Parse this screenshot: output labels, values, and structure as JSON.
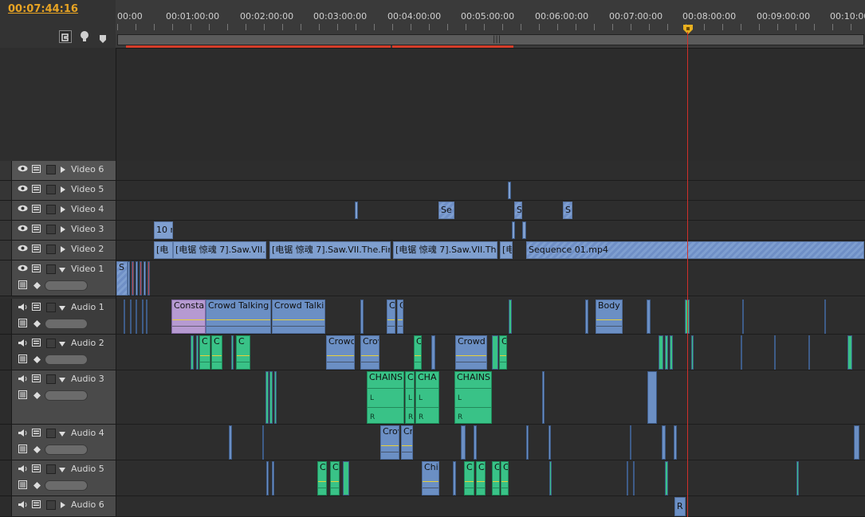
{
  "timecode": "00:07:44:16",
  "ruler": {
    "labels": [
      "00:00",
      "00:01:00:00",
      "00:02:00:00",
      "00:03:00:00",
      "00:04:00:00",
      "00:05:00:00",
      "00:06:00:00",
      "00:07:00:00",
      "00:08:00:00",
      "00:09:00:00",
      "00:10:00"
    ]
  },
  "header_icons": [
    "snap-icon",
    "marker-icon",
    "set-marker-icon"
  ],
  "tracks": {
    "video6": "Video 6",
    "video5": "Video 5",
    "video4": "Video 4",
    "video3": "Video 3",
    "video2": "Video 2",
    "video1": "Video 1",
    "audio1": "Audio 1",
    "audio2": "Audio 2",
    "audio3": "Audio 3",
    "audio4": "Audio 4",
    "audio5": "Audio 5",
    "audio6": "Audio 6"
  },
  "clips": {
    "v4_se": "Se",
    "v4_s1": "S",
    "v4_s2": "S",
    "v3_10": "10 r",
    "v2_c1": "[电",
    "v2_c2": "[电锯 惊魂 7].Saw.VII.",
    "v2_c3": "[电锯 惊魂 7].Saw.VII.The.Fin",
    "v2_c4": "[电锯 惊魂 7].Saw.VII.The",
    "v2_c5": "[电",
    "v2_seq": "Sequence 01.mp4",
    "v1_s": "S",
    "a1_const": "Constar",
    "a1_crowd1": "Crowd Talking",
    "a1_crowd2": "Crowd Talkir",
    "a1_c1": "C",
    "a1_c2": "C",
    "a1_body": "Body",
    "a2_c1": "C",
    "a2_c2": "C",
    "a2_c3": "C",
    "a2_crowd1": "Crowd",
    "a2_crow": "Crov",
    "a2_c4": "C",
    "a2_crowd2": "Crowd",
    "a2_c5": "C",
    "a3_chains1": "CHAINS",
    "a3_c": "C",
    "a3_cha": "CHA",
    "a3_chains2": "CHAINS",
    "a3_l": "L",
    "a3_r": "R",
    "a4_crow": "Crov",
    "a4_cr": "Cr",
    "a5_ch": "Chi",
    "a5_c1": "C",
    "a5_c2": "C",
    "a5_c3": "C",
    "a5_c4": "C",
    "a5_c5": "C",
    "a5_c6": "C",
    "a6_r": "R"
  },
  "colors": {
    "timecode": "#e8a423",
    "playhead": "#d0302a",
    "video_clip": "#7f9fcf",
    "audio_clip": "#6b8fc4",
    "green_clip": "#39c287"
  }
}
